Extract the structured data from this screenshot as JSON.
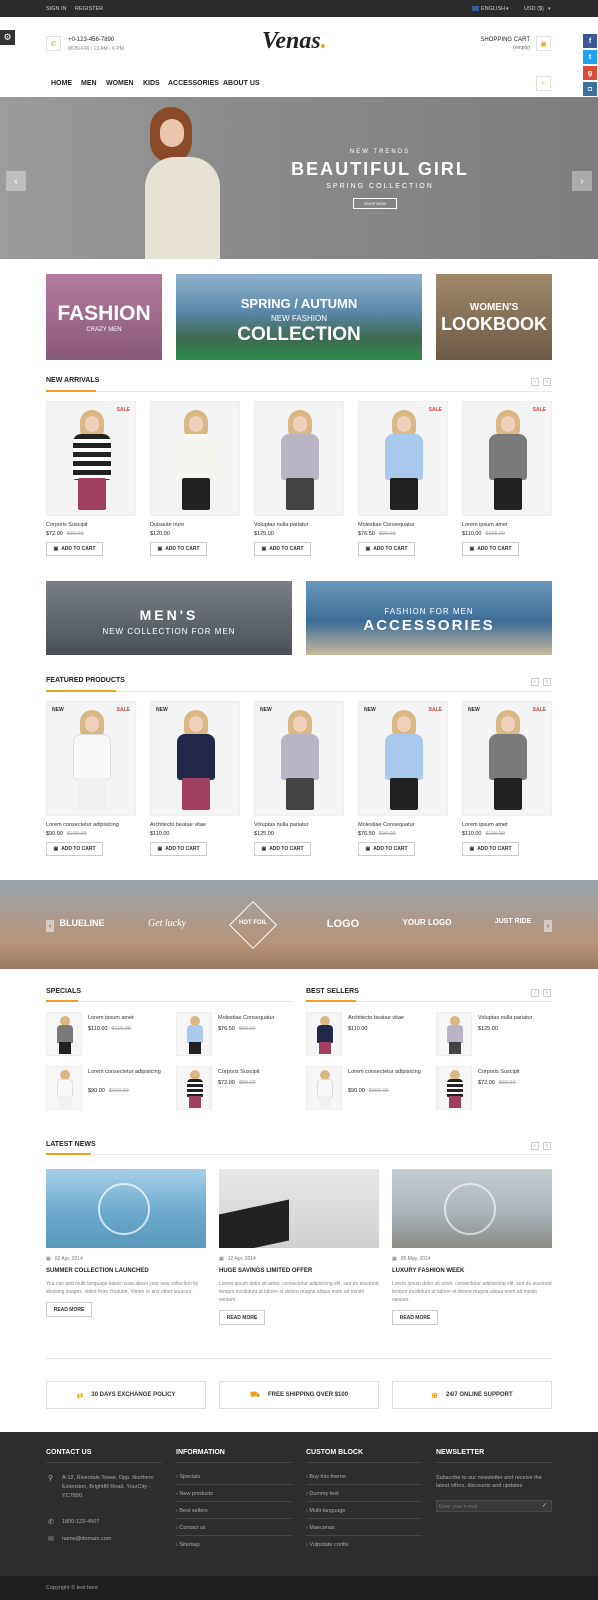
{
  "topbar": {
    "sign_in": "SIGN IN",
    "register": "REGISTER",
    "language": "ENGLISH",
    "currency": "USD ($)"
  },
  "header": {
    "phone": "+0-123-456-7890",
    "hours": "MON-FRI / 13 AM - 6 PM",
    "logo": "Venas",
    "cart_label": "SHOPPING CART",
    "cart_status": "(empty)"
  },
  "nav": {
    "items": [
      "HOME",
      "MEN",
      "WOMEN",
      "KIDS",
      "ACCESSORIES",
      "ABOUT US"
    ]
  },
  "hero": {
    "eyebrow": "NEW TRENDS",
    "title": "BEAUTIFUL GIRL",
    "subtitle": "SPRING COLLECTION",
    "button": "SHOP NOW"
  },
  "promos": {
    "fashion_title": "FASHION",
    "fashion_sub": "CRAZY MEN",
    "spring_title": "SPRING / AUTUMN",
    "spring_sub": "NEW FASHION",
    "spring_main": "COLLECTION",
    "women_title": "WOMEN'S",
    "women_main": "LOOKBOOK"
  },
  "new_arrivals": {
    "title": "NEW ARRIVALS",
    "products": [
      {
        "name": "Corporis Suscipit",
        "price": "$72.00",
        "old": "$80.00",
        "sale": "SALE",
        "new": ""
      },
      {
        "name": "Duisaute irure",
        "price": "$120.00",
        "old": "",
        "sale": "",
        "new": ""
      },
      {
        "name": "Voluptas nulla pariatur",
        "price": "$125.00",
        "old": "",
        "sale": "",
        "new": ""
      },
      {
        "name": "Molestiae Consequatur",
        "price": "$76.50",
        "old": "$90.00",
        "sale": "SALE",
        "new": ""
      },
      {
        "name": "Lorem ipsum amet",
        "price": "$110.00",
        "old": "$115.00",
        "sale": "SALE",
        "new": ""
      }
    ]
  },
  "add_to_cart": "ADD TO CART",
  "mid_banners": {
    "mens_title": "MEN'S",
    "mens_sub": "NEW COLLECTION FOR MEN",
    "acc_sub": "FASHION FOR MEN",
    "acc_title": "ACCESSORIES"
  },
  "featured": {
    "title": "FEATURED PRODUCTS",
    "products": [
      {
        "name": "Lorem consectetur adipisicing",
        "price": "$90.00",
        "old": "$100.00",
        "sale": "SALE",
        "new": "NEW"
      },
      {
        "name": "Architecto beatae vitae",
        "price": "$110.00",
        "old": "",
        "sale": "",
        "new": "NEW"
      },
      {
        "name": "Voluptas nulla pariatur",
        "price": "$125.00",
        "old": "",
        "sale": "",
        "new": "NEW"
      },
      {
        "name": "Molestiae Consequatur",
        "price": "$76.50",
        "old": "$90.00",
        "sale": "SALE",
        "new": "NEW"
      },
      {
        "name": "Lorem ipsum amet",
        "price": "$110.00",
        "old": "$115.00",
        "sale": "SALE",
        "new": "NEW"
      }
    ]
  },
  "brands": [
    "BLUELINE",
    "Get lucky",
    "HOT FOIL",
    "LOGO",
    "YOUR LOGO",
    "JUST RIDE"
  ],
  "specials": {
    "title": "SPECIALS",
    "items": [
      {
        "name": "Lorem ipsum amet",
        "price": "$110.00",
        "old": "$115.00"
      },
      {
        "name": "Molestiae Consequatur",
        "price": "$76.50",
        "old": "$90.00"
      },
      {
        "name": "Lorem consectetur adipisicing",
        "price": "$90.00",
        "old": "$100.00"
      },
      {
        "name": "Corporis Suscipit",
        "price": "$72.00",
        "old": "$80.00"
      }
    ]
  },
  "best_sellers": {
    "title": "BEST SELLERS",
    "items": [
      {
        "name": "Architecto beatae vitae",
        "price": "$110.00",
        "old": ""
      },
      {
        "name": "Voluptas nulla pariatur",
        "price": "$125.00",
        "old": ""
      },
      {
        "name": "Lorem consectetur adipisicing",
        "price": "$90.00",
        "old": "$100.00"
      },
      {
        "name": "Corporis Suscipit",
        "price": "$72.00",
        "old": "$80.00"
      }
    ]
  },
  "news": {
    "title": "LATEST NEWS",
    "read_more": "READ MORE",
    "posts": [
      {
        "date": "02 Apr, 2014",
        "title": "SUMMER COLLECTION LAUNCHED",
        "text": "You can add multi language latest news about your new collection by showing images, video from Youtube, Vimeo or any other sources."
      },
      {
        "date": "12 Apr, 2014",
        "title": "HUGE SAVINGS LIMITED OFFER",
        "text": "Lorem ipsum dolor sit amet, consectetur adipisicing elit, sed do eiusmod tempor incididunt ut labore et dolore magna aliqua enim ad minim veniam."
      },
      {
        "date": "05 May, 2014",
        "title": "LUXURY FASHION WEEK",
        "text": "Lorem ipsum dolor sit amet, consectetur adipisicing elit, sed do eiusmod tempor incididunt ut labore et dolore magna aliqua enim ad minim veniam."
      }
    ]
  },
  "features": [
    "30 DAYS EXCHANGE POLICY",
    "FREE SHIPPING OVER $100",
    "24/7 ONLINE SUPPORT"
  ],
  "footer": {
    "contact_title": "CONTACT US",
    "address": "A-12, Riverdale Tower, Opp. Northern Extension, Brightfill Road, YourCity - YC7890.",
    "phone": "1800-123-4567",
    "email": "name@domain.com",
    "info_title": "INFORMATION",
    "info_links": [
      "Specials",
      "New products",
      "Best sellers",
      "Contact us",
      "Sitemap"
    ],
    "custom_title": "CUSTOM BLOCK",
    "custom_links": [
      "Buy this theme",
      "Dummy text",
      "Multi-language",
      "Maecenas",
      "Vulputate confis"
    ],
    "newsletter_title": "NEWSLETTER",
    "newsletter_text": "Subscribe to our newsletter and receive the latest offers, discounts and updates",
    "newsletter_placeholder": "Enter your e-mail",
    "copyright": "Copyright © text here"
  },
  "colors": {
    "accent": "#f0a020",
    "dark": "#2b2b2b",
    "sale": "#e04040"
  }
}
